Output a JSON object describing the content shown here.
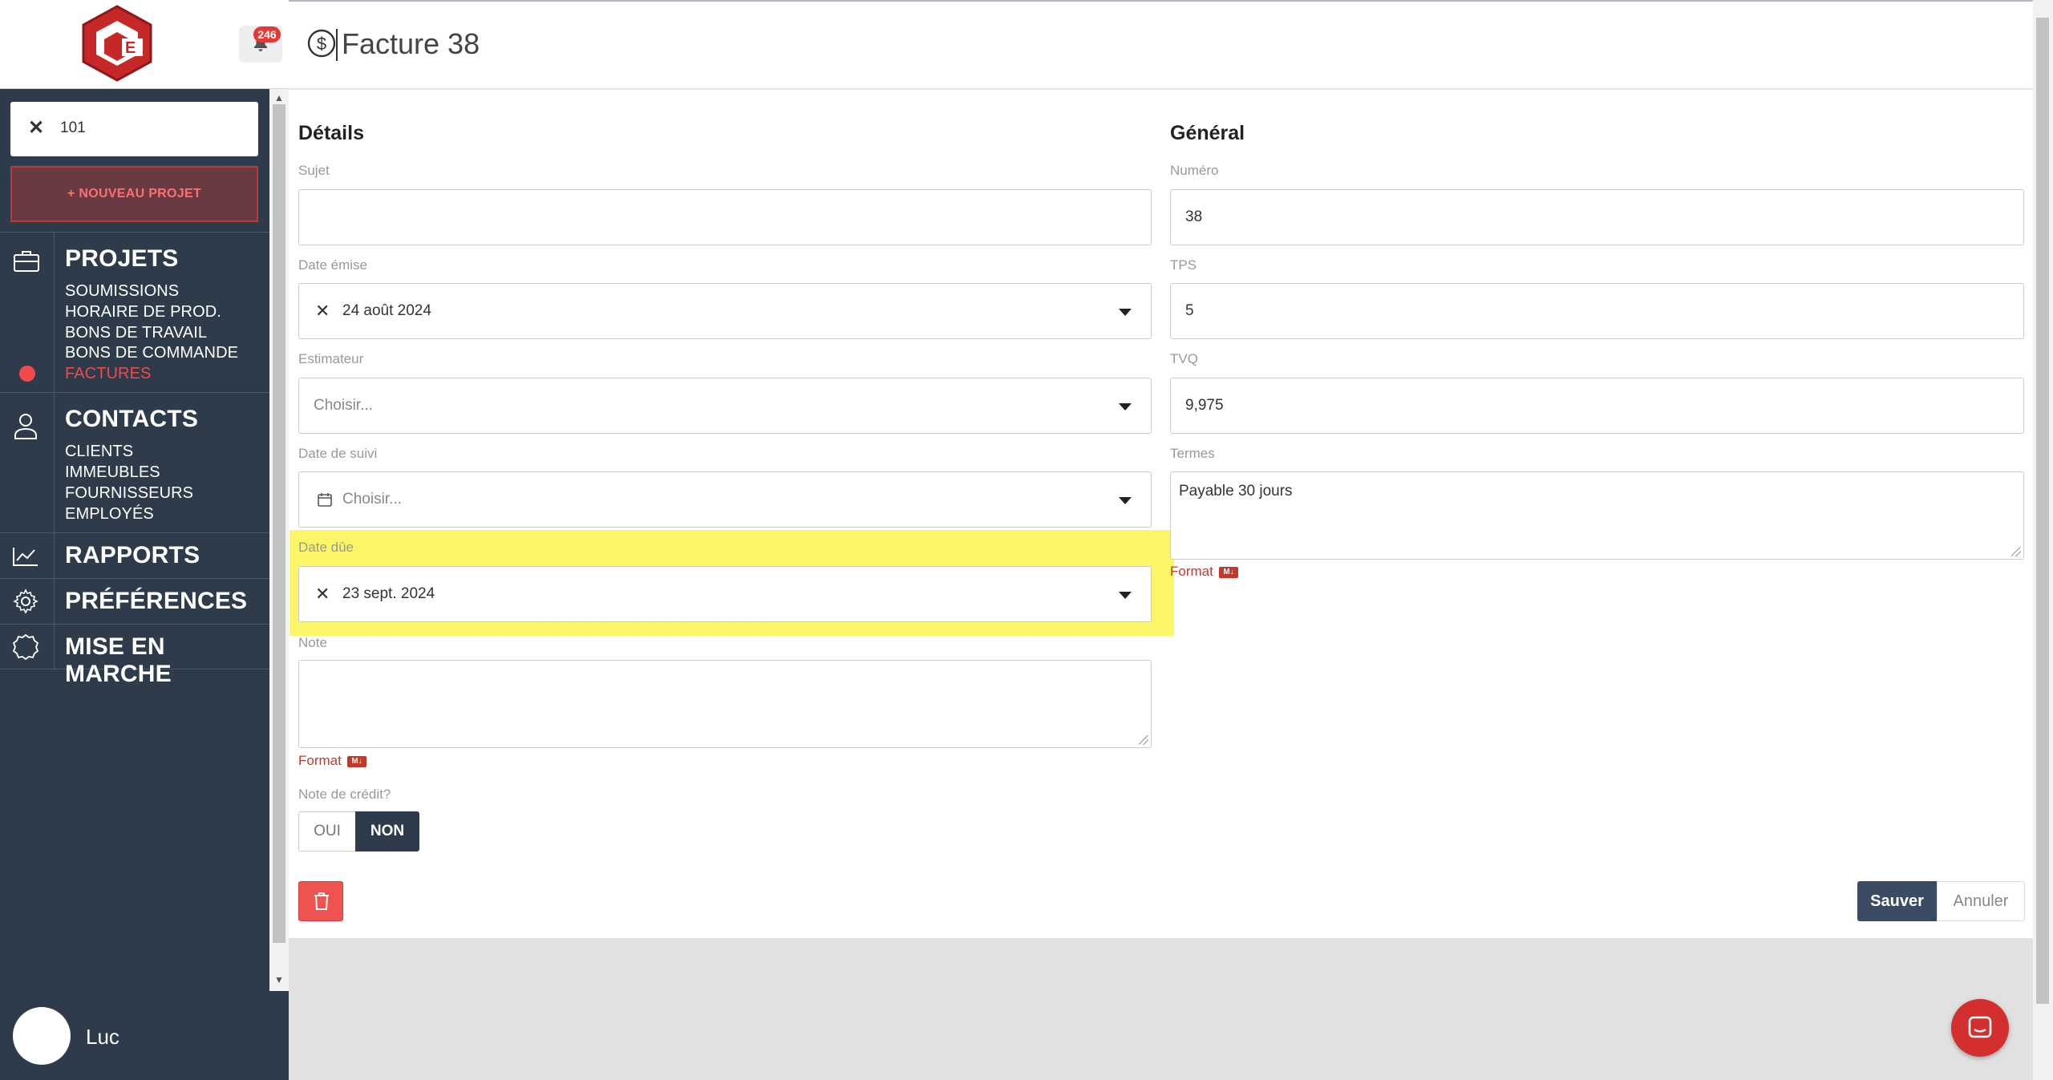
{
  "app": {
    "notifications_count": "246",
    "page_title": "Facture 38"
  },
  "sidebar": {
    "search_value": "101",
    "new_project_label": "+ NOUVEAU PROJET",
    "sections": [
      {
        "heading": "PROJETS",
        "icon": "briefcase-icon",
        "items": [
          "SOUMISSIONS",
          "HORAIRE DE PROD.",
          "BONS DE TRAVAIL",
          "BONS DE COMMANDE",
          "FACTURES"
        ],
        "active_item": "FACTURES"
      },
      {
        "heading": "CONTACTS",
        "icon": "user-icon",
        "items": [
          "CLIENTS",
          "IMMEUBLES",
          "FOURNISSEURS",
          "EMPLOYÉS"
        ]
      },
      {
        "heading": "RAPPORTS",
        "icon": "chart-icon",
        "items": []
      },
      {
        "heading": "PRÉFÉRENCES",
        "icon": "gear-icon",
        "items": []
      },
      {
        "heading": "MISE EN MARCHE",
        "icon": "badge-icon",
        "items": []
      }
    ],
    "user_name": "Luc"
  },
  "details": {
    "title": "Détails",
    "sujet": {
      "label": "Sujet",
      "value": ""
    },
    "date_emise": {
      "label": "Date émise",
      "value": "24 août 2024"
    },
    "estimateur": {
      "label": "Estimateur",
      "placeholder": "Choisir..."
    },
    "date_suivi": {
      "label": "Date de suivi",
      "placeholder": "Choisir..."
    },
    "date_due": {
      "label": "Date dûe",
      "value": "23 sept. 2024"
    },
    "note": {
      "label": "Note",
      "value": "",
      "format_label": "Format"
    },
    "credit_note": {
      "label": "Note de crédit?",
      "oui": "OUI",
      "non": "NON",
      "selected": "NON"
    }
  },
  "general": {
    "title": "Général",
    "numero": {
      "label": "Numéro",
      "value": "38"
    },
    "tps": {
      "label": "TPS",
      "value": "5"
    },
    "tvq": {
      "label": "TVQ",
      "value": "9,975"
    },
    "termes": {
      "label": "Termes",
      "value": "Payable 30 jours",
      "format_label": "Format"
    }
  },
  "actions": {
    "save_label": "Sauver",
    "cancel_label": "Annuler"
  },
  "colors": {
    "sidebar_bg": "#2e3b4b",
    "accent_red": "#f04a4a",
    "highlight": "#fbf667",
    "save_btn": "#3b4b63"
  }
}
